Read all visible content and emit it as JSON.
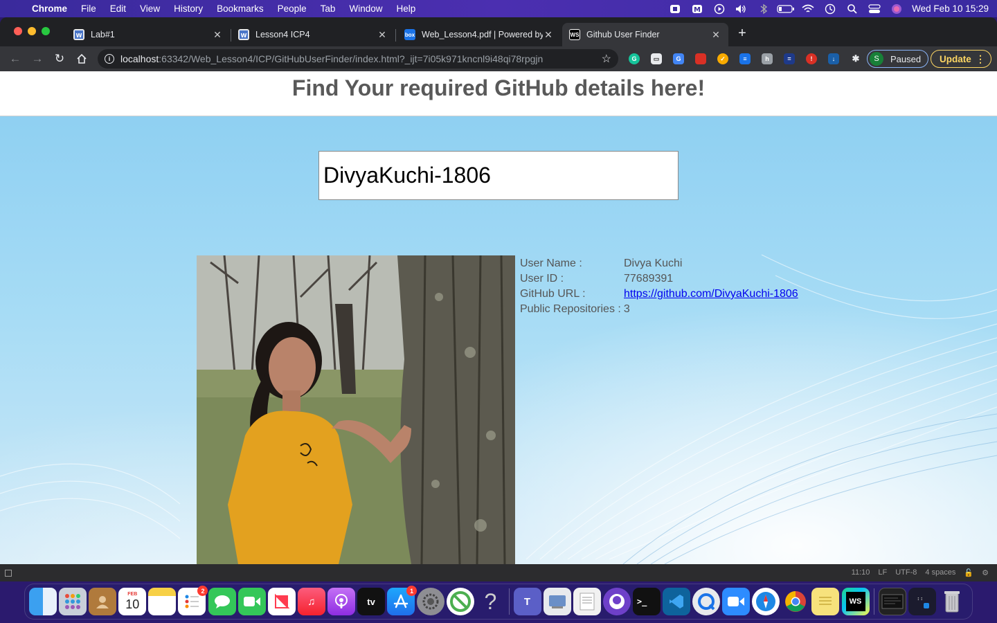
{
  "menubar": {
    "app_name": "Chrome",
    "items": [
      "File",
      "Edit",
      "View",
      "History",
      "Bookmarks",
      "People",
      "Tab",
      "Window",
      "Help"
    ],
    "clock": "Wed Feb 10  15:29"
  },
  "tabs": [
    {
      "title": "Lab#1",
      "favicon": "doc-icon",
      "active": false
    },
    {
      "title": "Lesson4 ICP4",
      "favicon": "doc-icon",
      "active": false
    },
    {
      "title": "Web_Lesson4.pdf | Powered by",
      "favicon": "box-icon",
      "active": false
    },
    {
      "title": "Github User Finder",
      "favicon": "webstorm-icon",
      "active": true
    }
  ],
  "toolbar": {
    "url_host": "localhost",
    "url_rest": ":63342/Web_Lesson4/ICP/GitHubUserFinder/index.html?_ijt=7i05k971kncnl9i48qi78rpgjn",
    "profile_initial": "S",
    "profile_label": "Paused",
    "update_label": "Update"
  },
  "page": {
    "heading": "Find Your required GitHub details here!",
    "search_value": "DivyaKuchi-1806",
    "details": {
      "username_label": "User Name :",
      "username_value": "Divya Kuchi",
      "userid_label": "User ID :",
      "userid_value": "77689391",
      "url_label": "GitHub URL :",
      "url_value": "https://github.com/DivyaKuchi-1806",
      "repos_label": "Public Repositories :",
      "repos_value": "3"
    }
  },
  "statusbar": {
    "position": "11:10",
    "line_ending": "LF",
    "encoding": "UTF-8",
    "indent": "4 spaces"
  },
  "dock": {
    "calendar_month": "FEB",
    "calendar_day": "10",
    "reminders_badge": "2",
    "appstore_badge": "1",
    "tv_label": "tv"
  },
  "colors": {
    "menubar": "#3a2a9c",
    "chrome_frame": "#202124",
    "chrome_toolbar": "#35363a",
    "heading_text": "#595959",
    "page_bg": "#a7dcf5",
    "link": "#0000ee"
  }
}
